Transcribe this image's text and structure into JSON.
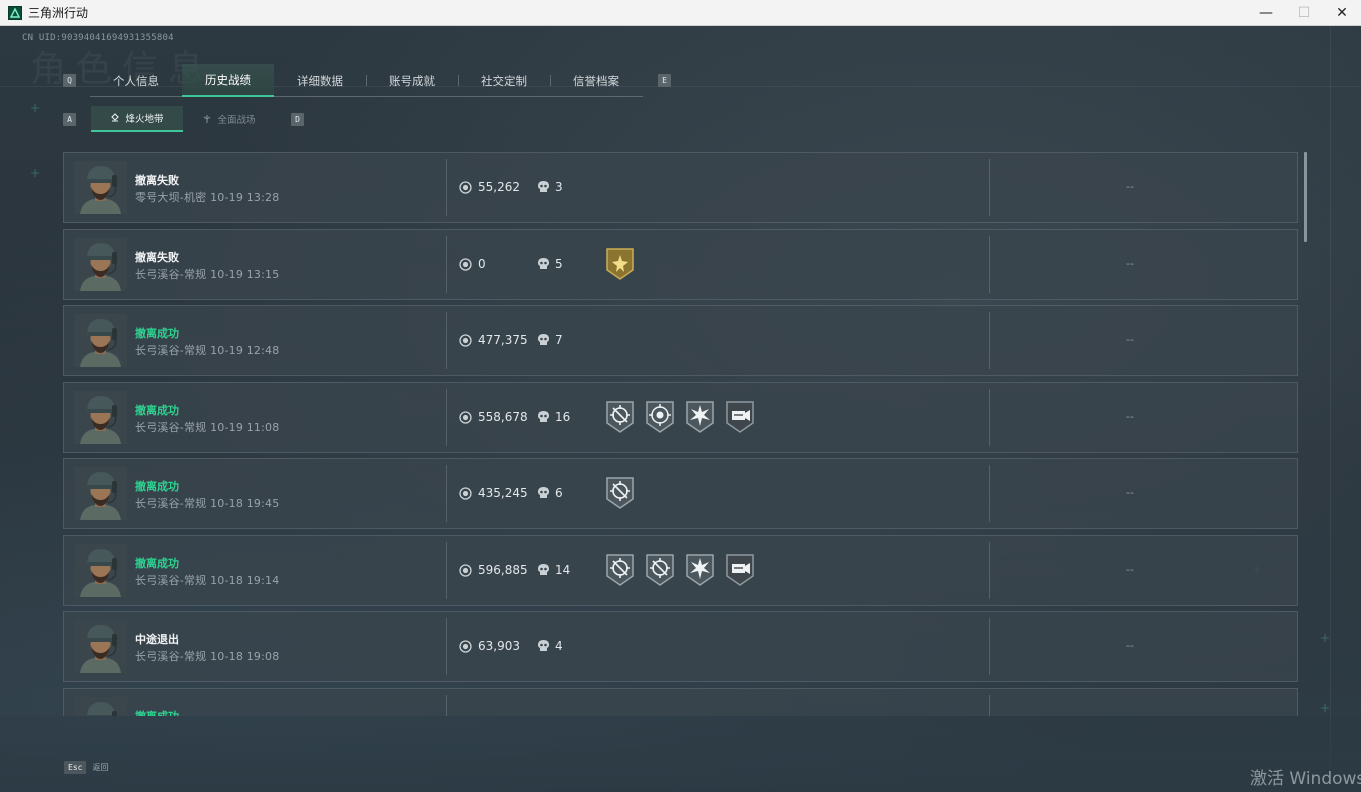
{
  "window": {
    "title": "三角洲行动",
    "minimize": "—",
    "maximize": "☐",
    "close": "✕"
  },
  "header": {
    "uid": "CN UID:9039404169493135580​4",
    "watermark": "角色信息"
  },
  "tabs": {
    "left_key": "Q",
    "right_key": "E",
    "items": [
      {
        "label": "个人信息"
      },
      {
        "label": "历史战绩"
      },
      {
        "label": "详细数据"
      },
      {
        "label": "账号成就"
      },
      {
        "label": "社交定制"
      },
      {
        "label": "信誉档案"
      }
    ],
    "active": "历史战绩"
  },
  "subtabs": {
    "left_key": "A",
    "right_key": "D",
    "items": [
      {
        "label": "烽火地带"
      },
      {
        "label": "全面战场"
      }
    ],
    "active": "烽火地带"
  },
  "records": [
    {
      "status": "撤离失败",
      "result": "fail",
      "meta": "零号大坝-机密 10-19 13:28",
      "money": "55,262",
      "kills": "3",
      "badges": [],
      "extra": "--"
    },
    {
      "status": "撤离失败",
      "result": "fail",
      "meta": "长弓溪谷-常规 10-19 13:15",
      "money": "0",
      "kills": "5",
      "badges": [
        "gold-star-badge"
      ],
      "extra": "--"
    },
    {
      "status": "撤离成功",
      "result": "success",
      "meta": "长弓溪谷-常规 10-19 12:48",
      "money": "477,375",
      "kills": "7",
      "badges": [],
      "extra": "--"
    },
    {
      "status": "撤离成功",
      "result": "success",
      "meta": "长弓溪谷-常规 10-19 11:08",
      "money": "558,678",
      "kills": "16",
      "badges": [
        "crosshair-badge",
        "skull-target-badge",
        "burst-badge",
        "supply-badge"
      ],
      "extra": "--"
    },
    {
      "status": "撤离成功",
      "result": "success",
      "meta": "长弓溪谷-常规 10-18 19:45",
      "money": "435,245",
      "kills": "6",
      "badges": [
        "crosshair-badge"
      ],
      "extra": "--"
    },
    {
      "status": "撤离成功",
      "result": "success",
      "meta": "长弓溪谷-常规 10-18 19:14",
      "money": "596,885",
      "kills": "14",
      "badges": [
        "crosshair-badge",
        "crosshair-badge",
        "burst-badge",
        "supply-badge"
      ],
      "extra": "--"
    },
    {
      "status": "中途退出",
      "result": "quit",
      "meta": "长弓溪谷-常规 10-18 19:08",
      "money": "63,903",
      "kills": "4",
      "badges": [],
      "extra": "--"
    },
    {
      "status": "撤离成功",
      "result": "success",
      "meta": "",
      "money": "",
      "kills": "",
      "badges": [],
      "extra": ""
    }
  ],
  "footer": {
    "esc_key": "Esc",
    "esc_label": "返回",
    "activate_windows": "激活 Windows"
  },
  "colors": {
    "accent": "#3ec89a",
    "success": "#2ed290",
    "row_bg": "#3a454d"
  }
}
